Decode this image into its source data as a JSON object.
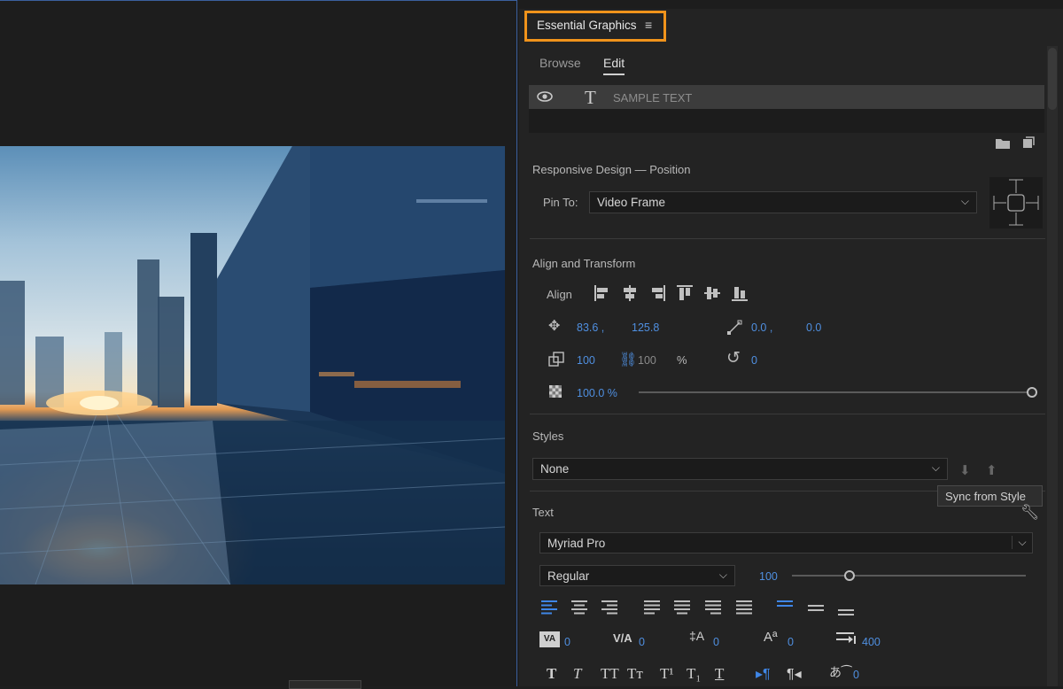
{
  "panel": {
    "title": "Essential Graphics",
    "tabs": [
      "Browse",
      "Edit"
    ],
    "active_tab": "Edit",
    "layer_name": "SAMPLE TEXT"
  },
  "responsive": {
    "title": "Responsive Design — Position",
    "pin_label": "Pin To:",
    "pin_value": "Video Frame"
  },
  "align": {
    "title": "Align and Transform",
    "align_label": "Align",
    "pos_x": "83.6 ,",
    "pos_y": "125.8",
    "anchor_x": "0.0 ,",
    "anchor_y": "0.0",
    "scale": "100",
    "scale_h": "100",
    "scale_unit": "%",
    "rotation": "0",
    "opacity": "100.0 %",
    "opacity_level": 1.0
  },
  "styles": {
    "title": "Styles",
    "value": "None",
    "tooltip": "Sync from Style"
  },
  "text": {
    "title": "Text",
    "font": "Myriad Pro",
    "weight": "Regular",
    "size": "100",
    "kerning": "0",
    "tracking": "0",
    "leading": "0",
    "baseline": "0",
    "tab_width": "400",
    "tsume": "0"
  },
  "colors": {
    "accent": "#4f8fe0",
    "highlight_border": "#f0931b"
  }
}
